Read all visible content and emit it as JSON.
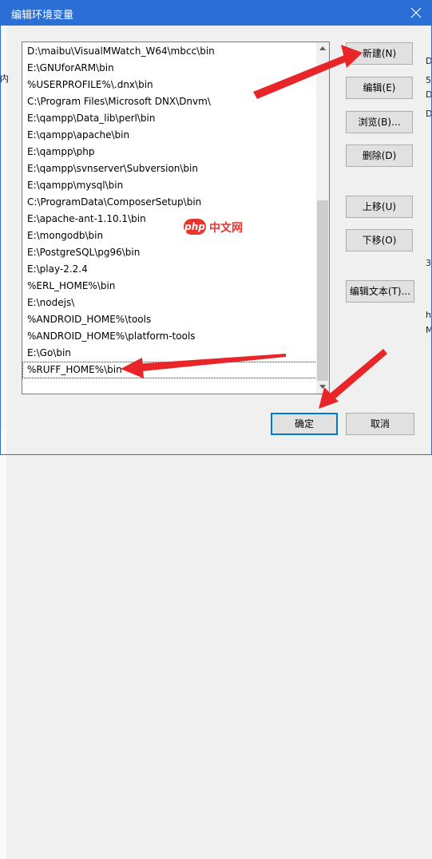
{
  "window": {
    "title": "编辑环境变量"
  },
  "list": {
    "items": [
      "D:\\maibu\\VisualMWatch_W64\\mbcc\\bin",
      "E:\\GNUforARM\\bin",
      "%USERPROFILE%\\.dnx\\bin",
      "C:\\Program Files\\Microsoft DNX\\Dnvm\\",
      "E:\\qampp\\Data_lib\\perl\\bin",
      "E:\\qampp\\apache\\bin",
      "E:\\qampp\\php",
      "E:\\qampp\\svnserver\\Subversion\\bin",
      "E:\\qampp\\mysql\\bin",
      "C:\\ProgramData\\ComposerSetup\\bin",
      "E:\\apache-ant-1.10.1\\bin",
      "E:\\mongodb\\bin",
      "E:\\PostgreSQL\\pg96\\bin",
      "E:\\play-2.2.4",
      "%ERL_HOME%\\bin",
      "E:\\nodejs\\",
      "%ANDROID_HOME%\\tools",
      "%ANDROID_HOME%\\platform-tools",
      "E:\\Go\\bin",
      "%RUFF_HOME%\\bin"
    ],
    "selected_index": 19
  },
  "buttons": {
    "new": "新建(N)",
    "edit": "编辑(E)",
    "browse": "浏览(B)...",
    "delete": "删除(D)",
    "move_up": "上移(U)",
    "move_down": "下移(O)",
    "edit_text": "编辑文本(T)...",
    "ok": "确定",
    "cancel": "取消"
  },
  "watermark": {
    "logo": "php",
    "text": "中文网"
  },
  "background_fragments": {
    "left": "内",
    "right": [
      "D",
      "5-",
      "D",
      "D",
      "3.",
      "h",
      "M"
    ]
  },
  "colors": {
    "titlebar": "#2b6fd6",
    "arrow": "#e8262a",
    "default_button_border": "#0078d7"
  }
}
